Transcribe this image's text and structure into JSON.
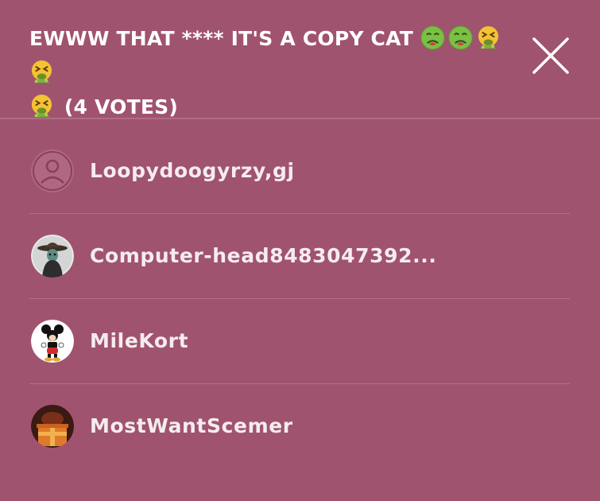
{
  "header": {
    "title": "EWWW THAT **** IT'S A COPY CAT",
    "vote_count": "(4 VOTES)",
    "reaction_emojis": [
      "nauseated-face-icon",
      "nauseated-face-icon",
      "vomiting-face-icon",
      "vomiting-face-icon",
      "vomiting-face-icon"
    ],
    "close_icon": "close-icon"
  },
  "voters": [
    {
      "username": "Loopydoogyrzy,gj",
      "avatar": "default-avatar-icon"
    },
    {
      "username": "Computer-head8483047392...",
      "avatar": "hat-character-avatar"
    },
    {
      "username": "MileKort",
      "avatar": "mouse-character-avatar"
    },
    {
      "username": "MostWantScemer",
      "avatar": "gift-box-avatar"
    }
  ],
  "colors": {
    "background": "#a0536f",
    "divider": "#b26e88",
    "text": "#ffffff"
  }
}
